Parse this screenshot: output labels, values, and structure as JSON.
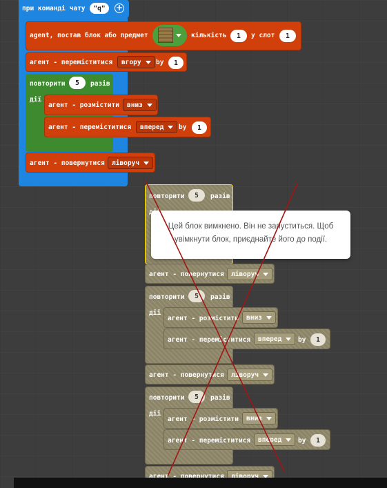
{
  "event": {
    "label": "при команді чату",
    "command": "\"q\""
  },
  "blocks": {
    "place_item": {
      "label": "agent, постав блок або предмет",
      "qty_label": "кількість",
      "qty": "1",
      "slot_label": "у слот",
      "slot": "1",
      "item_icon": "wood-block-icon"
    },
    "move_up": {
      "label": "агент - переміститися",
      "dir": "вгору",
      "by": "by",
      "n": "1"
    },
    "repeat": {
      "label": "повторити",
      "n": "5",
      "times": "разів",
      "do": "дії"
    },
    "place_down": {
      "label": "агент - розмістити",
      "dir": "вниз"
    },
    "move_fwd": {
      "label": "агент - переміститися",
      "dir": "вперед",
      "by": "by",
      "n": "1"
    },
    "turn_left": {
      "label": "агент - повернутися",
      "dir": "ліворуч"
    }
  },
  "disabled": {
    "tooltip": "Цей блок вимкнено. Він не запуститься. Щоб увімкнути блок, приєднайте його до події.",
    "repeat_label": "повторити",
    "repeat_n": "5",
    "times": "разів",
    "do": "дії",
    "turn_label": "агент - повернутися",
    "turn_dir": "ліворуч",
    "place_label": "агент - розмістити",
    "place_dir": "вниз",
    "move_label": "агент - переміститися",
    "move_dir": "вперед",
    "by": "by",
    "n": "1"
  },
  "colors": {
    "event": "#1e85e0",
    "agent": "#d1400b",
    "loop": "#3e8a2e",
    "disabled": "#8c8466",
    "cross": "#a31515"
  }
}
